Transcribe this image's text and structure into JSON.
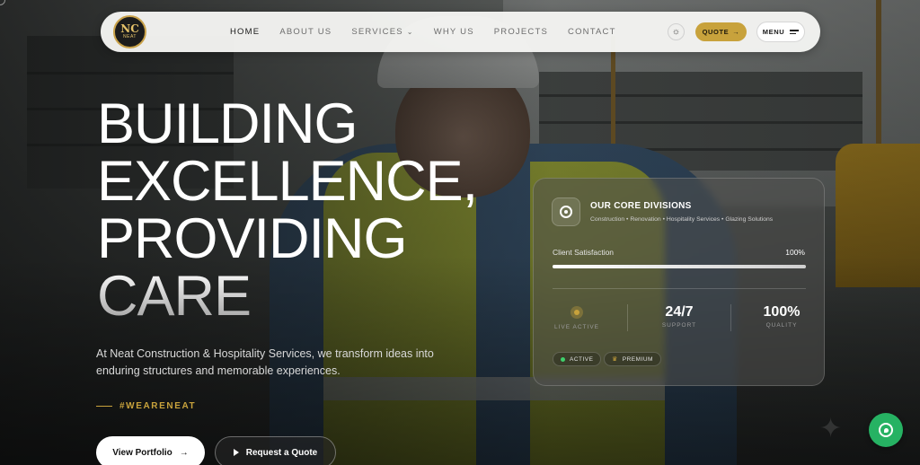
{
  "logo": {
    "mark": "NC",
    "word": "NEAT"
  },
  "nav": {
    "items": [
      {
        "label": "HOME",
        "active": true
      },
      {
        "label": "ABOUT US",
        "active": false
      },
      {
        "label": "SERVICES",
        "active": false,
        "dropdown": true
      },
      {
        "label": "WHY US",
        "active": false
      },
      {
        "label": "PROJECTS",
        "active": false
      },
      {
        "label": "CONTACT",
        "active": false
      }
    ],
    "quote_label": "QUOTE",
    "menu_label": "MENU"
  },
  "hero": {
    "line1": "BUILDING",
    "line2": "EXCELLENCE,",
    "line3": "PROVIDING",
    "line4": "CARE",
    "intro": "At Neat Construction & Hospitality Services, we transform ideas into enduring structures and memorable experiences.",
    "hashtag": "#WEARENEAT",
    "portfolio_label": "View Portfolio",
    "quote_label": "Request a Quote"
  },
  "card": {
    "title": "OUR CORE DIVISIONS",
    "subtitle": "Construction • Renovation • Hospitality Services • Glazing Solutions",
    "satisfaction_label": "Client Satisfaction",
    "satisfaction_value": "100%",
    "satisfaction_fraction": 1.0,
    "stats": [
      {
        "num": "",
        "label": "LIVE ACTIVE"
      },
      {
        "num": "24/7",
        "label": "SUPPORT"
      },
      {
        "num": "100%",
        "label": "QUALITY"
      }
    ],
    "tags": [
      {
        "label": "ACTIVE"
      },
      {
        "label": "PREMIUM"
      }
    ]
  },
  "colors": {
    "accent": "#c8a23c",
    "whatsapp": "#26b263",
    "status_active": "#3fcf6b"
  },
  "icons": {
    "theme": "sun-icon",
    "quote_arrow": "arrow-right-icon",
    "menu": "hamburger-icon",
    "division": "target-icon",
    "whatsapp": "whatsapp-icon",
    "play": "play-icon",
    "premium": "crown-icon"
  }
}
